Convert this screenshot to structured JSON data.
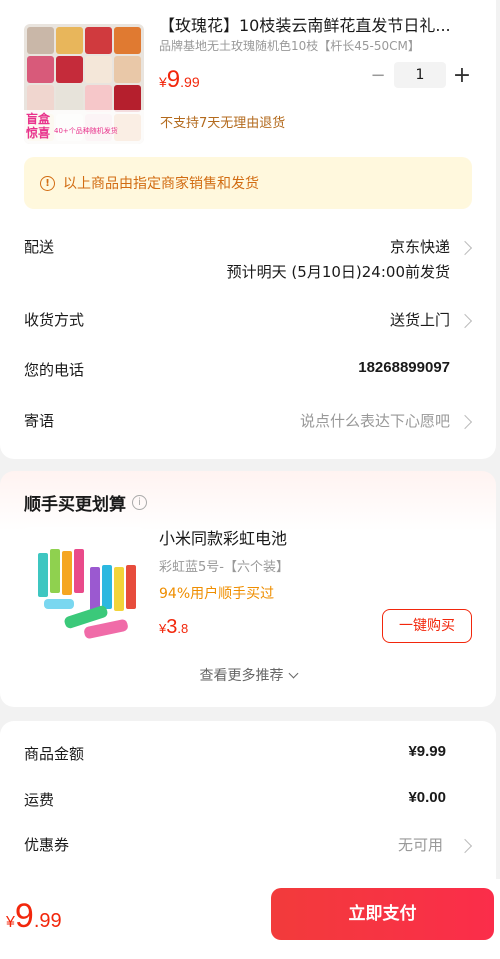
{
  "product": {
    "title": "【玫瑰花】10枝装云南鲜花直发节日礼...",
    "spec": "品牌基地无土玫瑰随机色10枝【杆长45-50CM】",
    "price": {
      "currency": "¥",
      "integer": "9",
      "decimal": ".99"
    },
    "quantity": "1",
    "minus": "−",
    "plus": "+",
    "no_refund": "不支持7天无理由退货",
    "image_tag_big": "盲盒惊喜",
    "image_tag_small": "40+个品种随机发货",
    "image_icon": "rose-box-image"
  },
  "notice": {
    "text": "以上商品由指定商家销售和发货",
    "icon": "info-icon"
  },
  "delivery": {
    "label": "配送",
    "carrier": "京东快递",
    "eta": "预计明天 (5月10日)24:00前发货"
  },
  "receive": {
    "label": "收货方式",
    "value": "送货上门"
  },
  "phone": {
    "label": "您的电话",
    "value": "18268899097"
  },
  "message": {
    "label": "寄语",
    "placeholder": "说点什么表达下心愿吧"
  },
  "recommend": {
    "title": "顺手买更划算",
    "item": {
      "name": "小米同款彩虹电池",
      "spec": "彩虹蓝5号-【六个装】",
      "stat": "94%用户顺手买过",
      "price": {
        "currency": "¥",
        "integer": "3",
        "decimal": ".8"
      },
      "buy_label": "一键购买"
    },
    "more_label": "查看更多推荐"
  },
  "summary": {
    "goods_label": "商品金额",
    "goods_value": "¥9.99",
    "shipping_label": "运费",
    "shipping_value": "¥0.00",
    "coupon_label": "优惠券",
    "coupon_value": "无可用"
  },
  "footer": {
    "price": {
      "currency": "¥",
      "integer": "9",
      "decimal": ".99"
    },
    "pay_label": "立即支付"
  },
  "colors": {
    "accent": "#f2270c",
    "notice_bg": "#fff8dd",
    "notice_text": "#d26c12",
    "pay_button": "#f23b3b"
  }
}
